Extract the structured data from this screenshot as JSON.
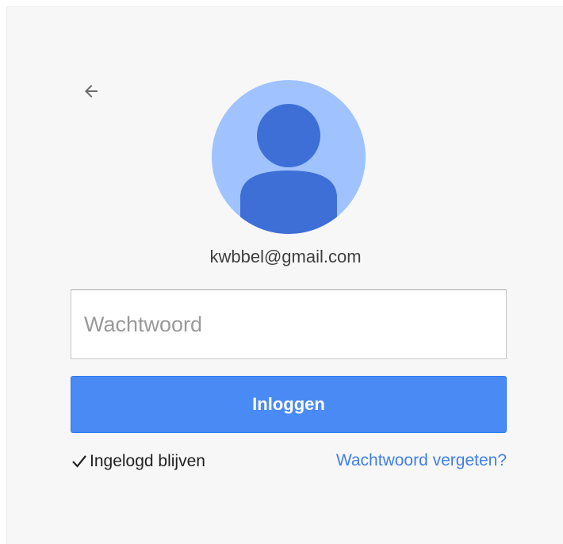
{
  "account": {
    "email": "kwbbel@gmail.com"
  },
  "password_field": {
    "placeholder": "Wachtwoord",
    "value": ""
  },
  "login_button": {
    "label": "Inloggen"
  },
  "stay_signed_in": {
    "label": "Ingelogd blijven",
    "checked": true
  },
  "forgot_link": {
    "label": "Wachtwoord vergeten?"
  },
  "icons": {
    "back": "arrow-left-icon",
    "avatar": "default-user-avatar",
    "checkbox": "checkmark-icon"
  },
  "colors": {
    "primary_button": "#4a8af4",
    "link": "#427fed",
    "avatar_background": "#a0c3ff",
    "avatar_figure": "#3e6fd7"
  }
}
